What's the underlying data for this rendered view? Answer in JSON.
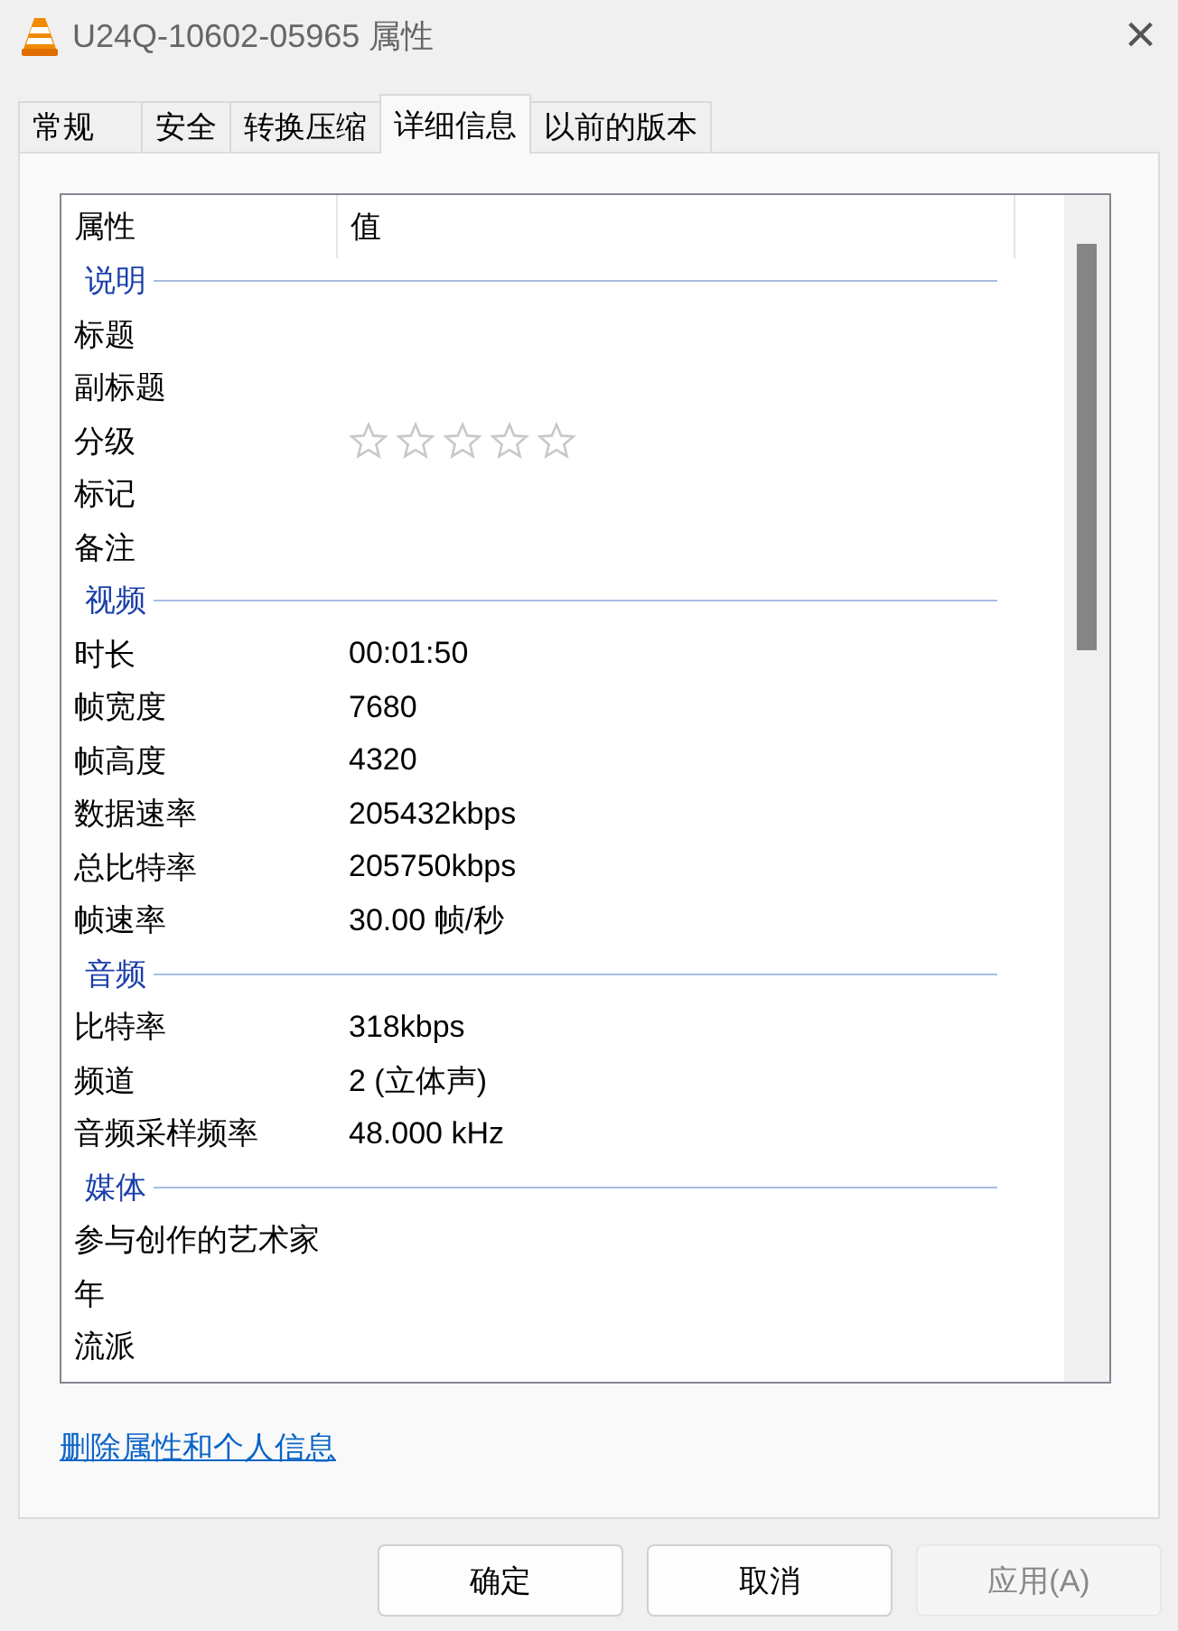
{
  "window": {
    "title": "U24Q-10602-05965 属性",
    "close": "×"
  },
  "tabs": [
    {
      "label": "常规",
      "selected": false
    },
    {
      "label": "安全",
      "selected": false
    },
    {
      "label": "转换压缩",
      "selected": false
    },
    {
      "label": "详细信息",
      "selected": true
    },
    {
      "label": "以前的版本",
      "selected": false
    }
  ],
  "table": {
    "columns": [
      "属性",
      "值"
    ],
    "rows": [
      {
        "kind": "section",
        "name": "说明"
      },
      {
        "kind": "property",
        "name": "标题"
      },
      {
        "kind": "property",
        "name": "副标题"
      },
      {
        "kind": "rating",
        "name": "分级",
        "stars": 0
      },
      {
        "kind": "property",
        "name": "标记"
      },
      {
        "kind": "property",
        "name": "备注"
      },
      {
        "kind": "section",
        "name": "视频"
      },
      {
        "kind": "property",
        "name": "时长",
        "value": "00:01:50"
      },
      {
        "kind": "property",
        "name": "帧宽度",
        "value": "7680"
      },
      {
        "kind": "property",
        "name": "帧高度",
        "value": "4320"
      },
      {
        "kind": "property",
        "name": "数据速率",
        "value": "205432kbps"
      },
      {
        "kind": "property",
        "name": "总比特率",
        "value": "205750kbps"
      },
      {
        "kind": "property",
        "name": "帧速率",
        "value": "30.00 帧/秒"
      },
      {
        "kind": "section",
        "name": "音频"
      },
      {
        "kind": "property",
        "name": "比特率",
        "value": "318kbps"
      },
      {
        "kind": "property",
        "name": "频道",
        "value": "2 (立体声)"
      },
      {
        "kind": "property",
        "name": "音频采样频率",
        "value": "48.000 kHz"
      },
      {
        "kind": "section",
        "name": "媒体"
      },
      {
        "kind": "property",
        "name": "参与创作的艺术家"
      },
      {
        "kind": "property",
        "name": "年"
      },
      {
        "kind": "property",
        "name": "流派"
      }
    ]
  },
  "link": "删除属性和个人信息",
  "buttons": [
    {
      "label": "确定",
      "disabled": false
    },
    {
      "label": "取消",
      "disabled": false
    },
    {
      "label": "应用(A)",
      "disabled": true
    }
  ]
}
